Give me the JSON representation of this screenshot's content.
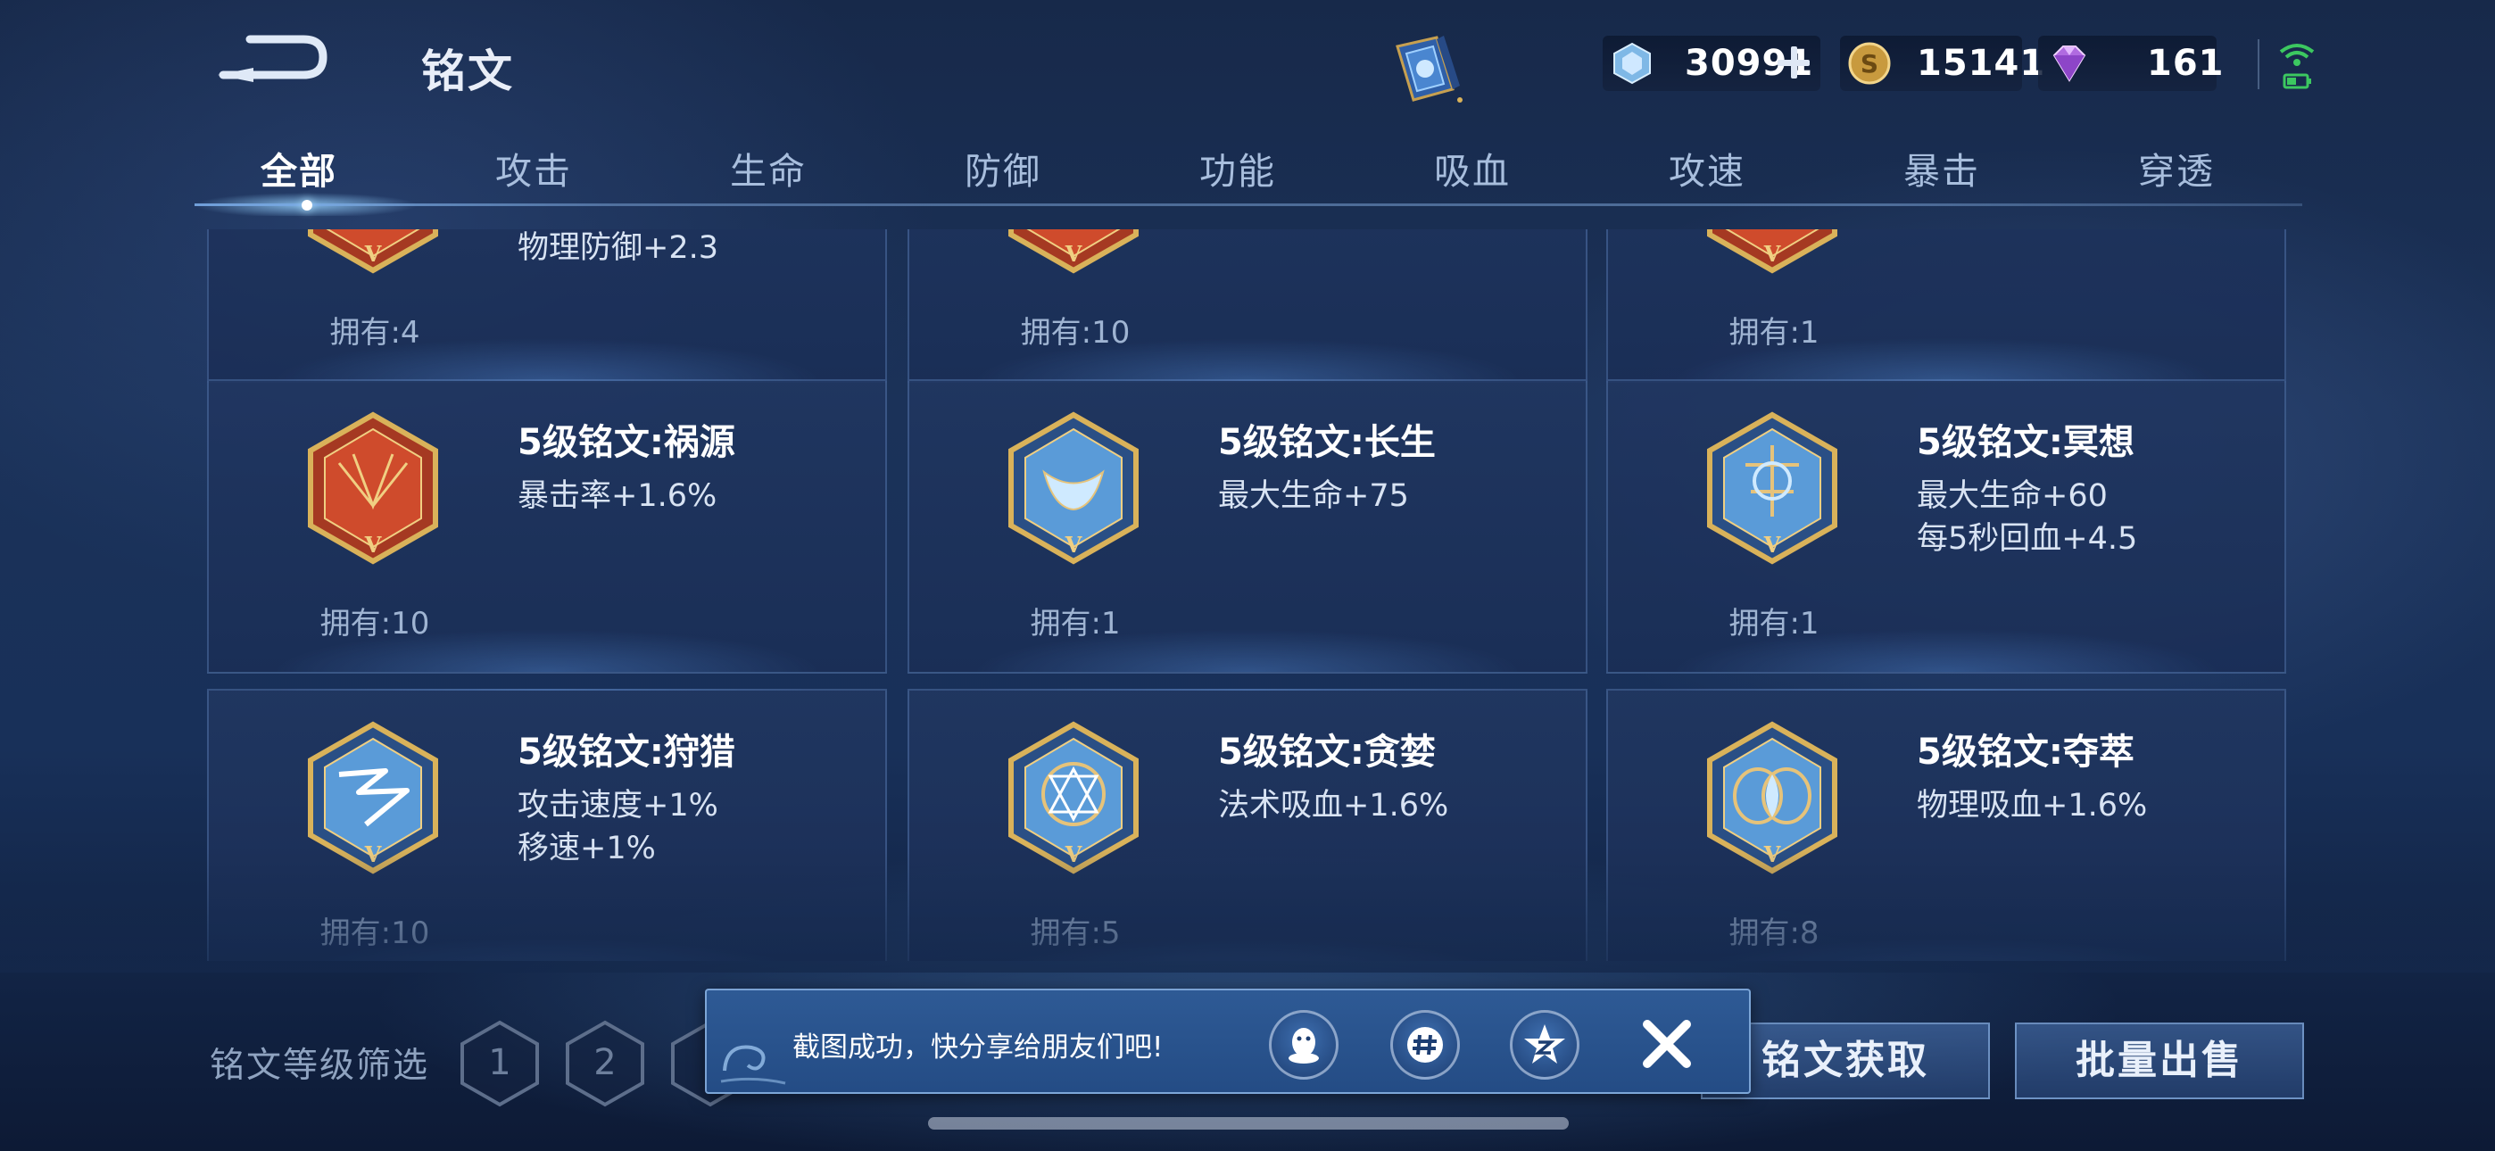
{
  "header": {
    "title": "铭文",
    "currencies": [
      {
        "name": "diamond-coupon",
        "value": "30991"
      },
      {
        "name": "gold",
        "value": "15141"
      },
      {
        "name": "gem",
        "value": "161"
      }
    ]
  },
  "tabs": [
    {
      "label": "全部",
      "active": true
    },
    {
      "label": "攻击"
    },
    {
      "label": "生命"
    },
    {
      "label": "防御"
    },
    {
      "label": "功能"
    },
    {
      "label": "吸血"
    },
    {
      "label": "攻速"
    },
    {
      "label": "暴击"
    },
    {
      "label": "穿透"
    }
  ],
  "cards": [
    {
      "name": "",
      "stats": [
        "物理防御+2.3"
      ],
      "owned": "拥有:4",
      "color": "red",
      "partial": true
    },
    {
      "name": "",
      "stats": [],
      "owned": "拥有:10",
      "color": "red",
      "partial": true
    },
    {
      "name": "",
      "stats": [],
      "owned": "拥有:1",
      "color": "red",
      "partial": true
    },
    {
      "name": "5级铭文:祸源",
      "stats": [
        "暴击率+1.6%"
      ],
      "owned": "拥有:10",
      "color": "red"
    },
    {
      "name": "5级铭文:长生",
      "stats": [
        "最大生命+75"
      ],
      "owned": "拥有:1",
      "color": "blue"
    },
    {
      "name": "5级铭文:冥想",
      "stats": [
        "最大生命+60",
        "每5秒回血+4.5"
      ],
      "owned": "拥有:1",
      "color": "blue"
    },
    {
      "name": "5级铭文:狩猎",
      "stats": [
        "攻击速度+1%",
        "移速+1%"
      ],
      "owned": "拥有:10",
      "color": "blue"
    },
    {
      "name": "5级铭文:贪婪",
      "stats": [
        "法术吸血+1.6%"
      ],
      "owned": "拥有:5",
      "color": "blue"
    },
    {
      "name": "5级铭文:夺萃",
      "stats": [
        "物理吸血+1.6%"
      ],
      "owned": "拥有:8",
      "color": "blue"
    }
  ],
  "rune_level_mark": "V",
  "footer": {
    "filter_label": "铭文等级筛选",
    "levels": [
      "1",
      "2"
    ],
    "obtain_button": "铭文获取",
    "sell_button": "批量出售"
  },
  "toast": {
    "message": "截图成功，快分享给朋友们吧!"
  },
  "colors": {
    "accent": "#aee0ff",
    "rune_red": "#c8442a",
    "rune_blue": "#4d87c4",
    "rune_gold": "#d9b25a"
  }
}
